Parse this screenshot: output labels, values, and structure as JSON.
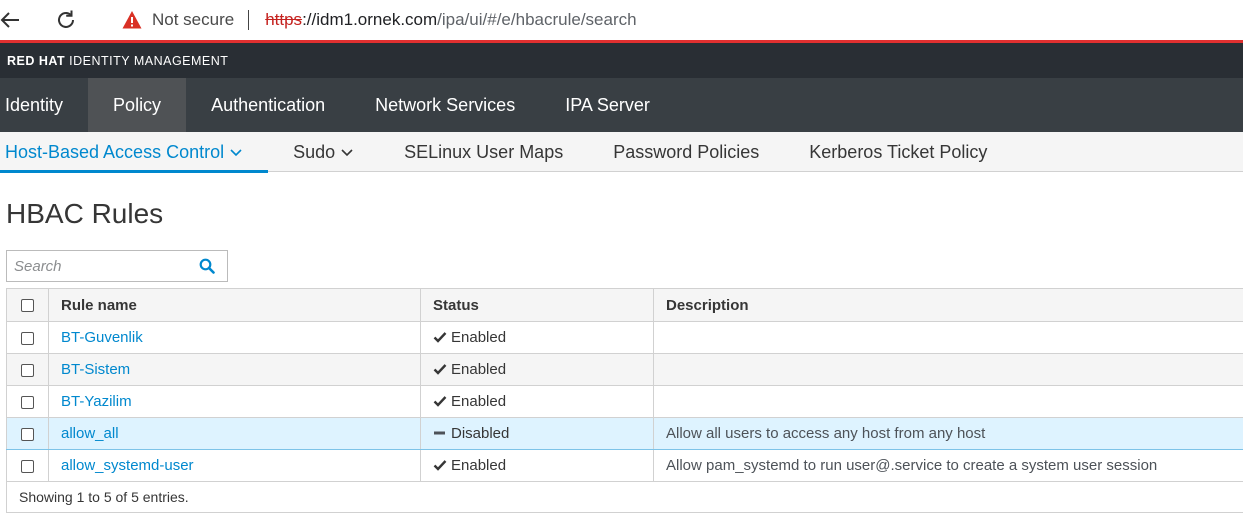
{
  "browser": {
    "not_secure_label": "Not secure",
    "url_scheme": "https",
    "url_host": "://idm1.ornek.com",
    "url_path": "/ipa/ui/#/e/hbacrule/search"
  },
  "masthead": {
    "brand_strong": "RED HAT",
    "brand_light": "IDENTITY MANAGEMENT"
  },
  "primary_nav": [
    {
      "label": "Identity",
      "active": false
    },
    {
      "label": "Policy",
      "active": true
    },
    {
      "label": "Authentication",
      "active": false
    },
    {
      "label": "Network Services",
      "active": false
    },
    {
      "label": "IPA Server",
      "active": false
    }
  ],
  "secondary_nav": [
    {
      "label": "Host-Based Access Control",
      "dropdown": true,
      "active": true
    },
    {
      "label": "Sudo",
      "dropdown": true,
      "active": false
    },
    {
      "label": "SELinux User Maps",
      "dropdown": false,
      "active": false
    },
    {
      "label": "Password Policies",
      "dropdown": false,
      "active": false
    },
    {
      "label": "Kerberos Ticket Policy",
      "dropdown": false,
      "active": false
    }
  ],
  "page": {
    "title": "HBAC Rules"
  },
  "search": {
    "placeholder": "Search",
    "value": ""
  },
  "table": {
    "columns": [
      "Rule name",
      "Status",
      "Description"
    ],
    "rows": [
      {
        "name": "BT-Guvenlik",
        "status": "Enabled",
        "status_icon": "check-icon",
        "description": ""
      },
      {
        "name": "BT-Sistem",
        "status": "Enabled",
        "status_icon": "check-icon",
        "description": ""
      },
      {
        "name": "BT-Yazilim",
        "status": "Enabled",
        "status_icon": "check-icon",
        "description": ""
      },
      {
        "name": "allow_all",
        "status": "Disabled",
        "status_icon": "minus-icon",
        "description": "Allow all users to access any host from any host"
      },
      {
        "name": "allow_systemd-user",
        "status": "Enabled",
        "status_icon": "check-icon",
        "description": "Allow pam_systemd to run user@.service to create a system user session"
      }
    ],
    "footer": "Showing 1 to 5 of 5 entries."
  },
  "colors": {
    "accent": "#0088ce",
    "masthead_bg": "#292e34",
    "primary_nav_bg": "#393f44",
    "security_red": "#c5221f"
  }
}
